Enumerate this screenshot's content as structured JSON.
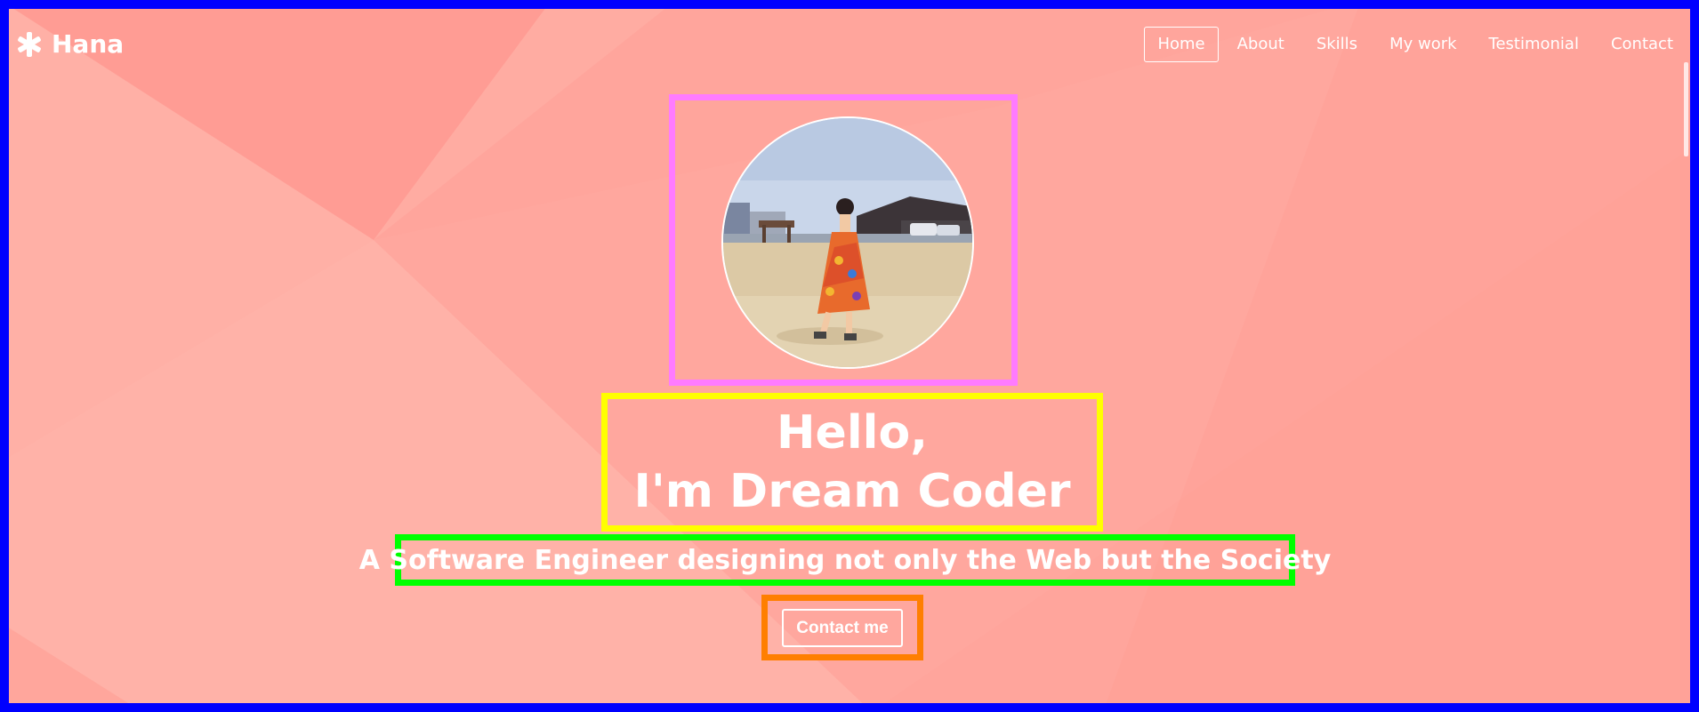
{
  "brand": {
    "name": "Hana",
    "icon": "asterisk-icon"
  },
  "nav": {
    "items": [
      {
        "label": "Home",
        "active": true
      },
      {
        "label": "About",
        "active": false
      },
      {
        "label": "Skills",
        "active": false
      },
      {
        "label": "My work",
        "active": false
      },
      {
        "label": "Testimonial",
        "active": false
      },
      {
        "label": "Contact",
        "active": false
      }
    ]
  },
  "hero": {
    "greeting": "Hello,",
    "name_line": "I'm Dream Coder",
    "tagline": "A Software Engineer designing not only the Web but the Society",
    "cta_label": "Contact me"
  },
  "colors": {
    "background": "#ffa59c",
    "text": "#ffffff",
    "frame_border": "#0000ff",
    "avatar_outline": "#ff7bff",
    "title_outline": "#ffff00",
    "tagline_outline": "#00ff00",
    "cta_outline": "#ff7f00"
  }
}
